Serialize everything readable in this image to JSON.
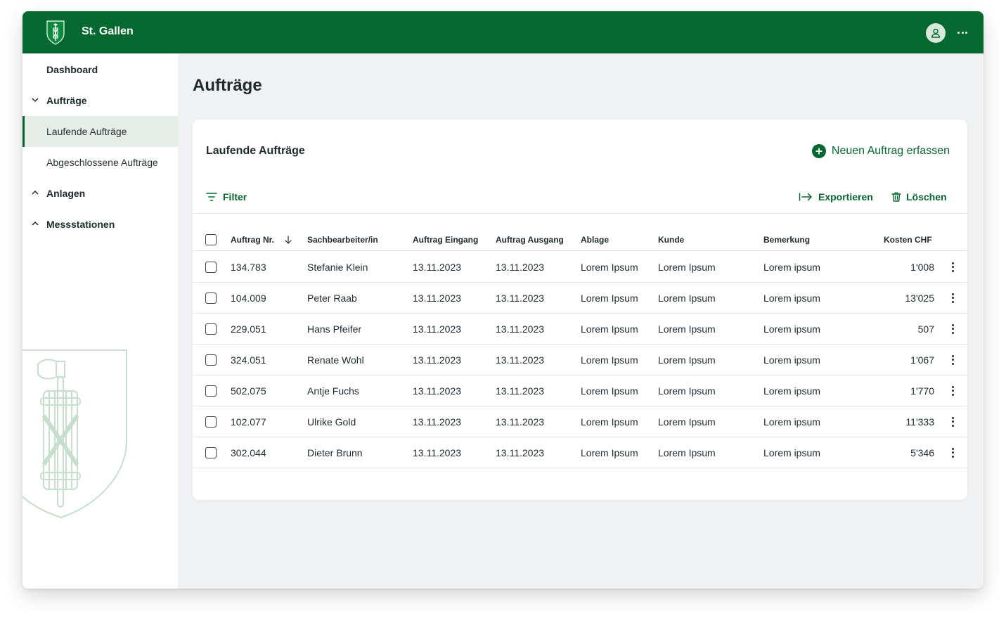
{
  "app": {
    "title": "St. Gallen",
    "logo_icon": "st-gallen-crest-icon",
    "user_icon": "user-avatar-icon",
    "more_icon": "more-horizontal-icon"
  },
  "colors": {
    "primary": "#05692f",
    "active_bg": "#e4ede6",
    "page_bg": "#f0f1f2",
    "crest_line": "#c5dfcc"
  },
  "sidebar": {
    "items": [
      {
        "label": "Dashboard",
        "type": "top"
      },
      {
        "label": "Aufträge",
        "type": "group",
        "state": "expanded"
      },
      {
        "label": "Laufende Aufträge",
        "type": "sub",
        "active": true
      },
      {
        "label": "Abgeschlossene Aufträge",
        "type": "sub",
        "active": false
      },
      {
        "label": "Anlagen",
        "type": "group",
        "state": "collapsed"
      },
      {
        "label": "Messstationen",
        "type": "group",
        "state": "collapsed"
      }
    ]
  },
  "page": {
    "title": "Aufträge"
  },
  "card": {
    "title": "Laufende Aufträge",
    "new_button": "Neuen Auftrag erfassen",
    "filter_button": "Filter",
    "export_button": "Exportieren",
    "delete_button": "Löschen"
  },
  "table": {
    "columns": {
      "nr": "Auftrag Nr.",
      "sachbearbeiter": "Sachbearbeiter/in",
      "eingang": "Auftrag Eingang",
      "ausgang": "Auftrag Ausgang",
      "ablage": "Ablage",
      "kunde": "Kunde",
      "bemerkung": "Bemerkung",
      "kosten": "Kosten CHF"
    },
    "sort_icon": "arrow-down-icon",
    "rows": [
      {
        "nr": "134.783",
        "sachbearbeiter": "Stefanie Klein",
        "eingang": "13.11.2023",
        "ausgang": "13.11.2023",
        "ablage": "Lorem Ipsum",
        "kunde": "Lorem Ipsum",
        "bemerkung": "Lorem ipsum",
        "kosten": "1'008"
      },
      {
        "nr": "104.009",
        "sachbearbeiter": "Peter Raab",
        "eingang": "13.11.2023",
        "ausgang": "13.11.2023",
        "ablage": "Lorem Ipsum",
        "kunde": "Lorem Ipsum",
        "bemerkung": "Lorem ipsum",
        "kosten": "13'025"
      },
      {
        "nr": "229.051",
        "sachbearbeiter": "Hans Pfeifer",
        "eingang": "13.11.2023",
        "ausgang": "13.11.2023",
        "ablage": "Lorem Ipsum",
        "kunde": "Lorem Ipsum",
        "bemerkung": "Lorem ipsum",
        "kosten": "507"
      },
      {
        "nr": "324.051",
        "sachbearbeiter": "Renate Wohl",
        "eingang": "13.11.2023",
        "ausgang": "13.11.2023",
        "ablage": "Lorem Ipsum",
        "kunde": "Lorem Ipsum",
        "bemerkung": "Lorem ipsum",
        "kosten": "1'067"
      },
      {
        "nr": "502.075",
        "sachbearbeiter": "Antje Fuchs",
        "eingang": "13.11.2023",
        "ausgang": "13.11.2023",
        "ablage": "Lorem Ipsum",
        "kunde": "Lorem Ipsum",
        "bemerkung": "Lorem ipsum",
        "kosten": "1'770"
      },
      {
        "nr": "102.077",
        "sachbearbeiter": "Ulrike Gold",
        "eingang": "13.11.2023",
        "ausgang": "13.11.2023",
        "ablage": "Lorem Ipsum",
        "kunde": "Lorem Ipsum",
        "bemerkung": "Lorem ipsum",
        "kosten": "11'333"
      },
      {
        "nr": "302.044",
        "sachbearbeiter": "Dieter Brunn",
        "eingang": "13.11.2023",
        "ausgang": "13.11.2023",
        "ablage": "Lorem Ipsum",
        "kunde": "Lorem Ipsum",
        "bemerkung": "Lorem ipsum",
        "kosten": "5'346"
      }
    ]
  }
}
